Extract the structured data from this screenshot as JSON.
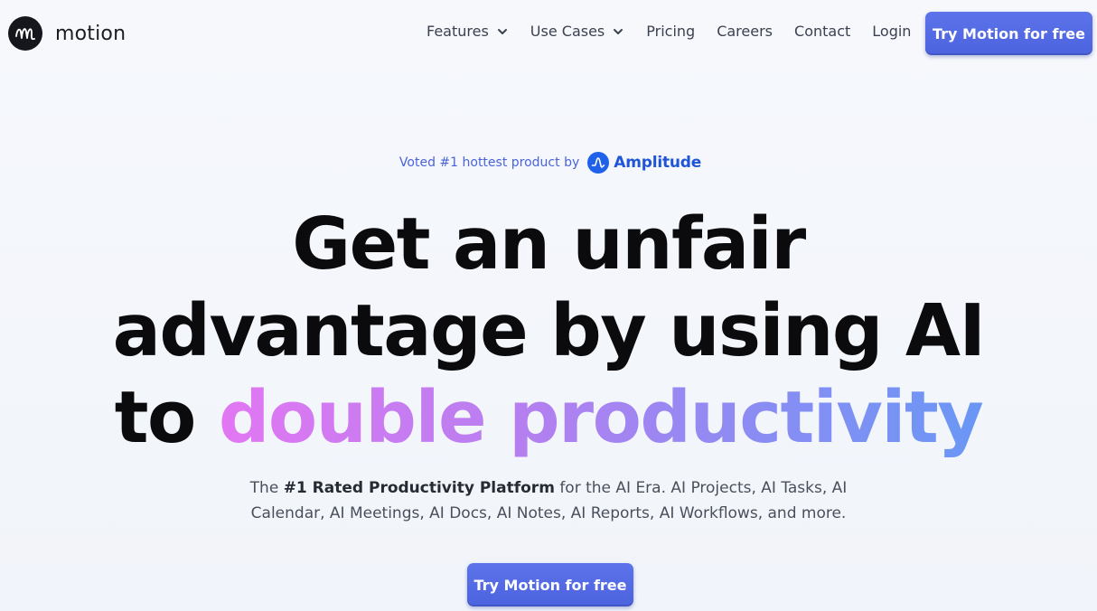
{
  "header": {
    "logo_text": "motion",
    "logo_icon": "motion-logo-icon",
    "nav": [
      {
        "label": "Features",
        "has_dropdown": true
      },
      {
        "label": "Use Cases",
        "has_dropdown": true
      },
      {
        "label": "Pricing",
        "has_dropdown": false
      },
      {
        "label": "Careers",
        "has_dropdown": false
      },
      {
        "label": "Contact",
        "has_dropdown": false
      },
      {
        "label": "Login",
        "has_dropdown": false
      }
    ],
    "cta_label": "Try Motion for free"
  },
  "hero": {
    "badge_text": "Voted #1 hottest product by",
    "badge_brand": "Amplitude",
    "badge_icon": "amplitude-logo-icon",
    "headline_line1": "Get an unfair",
    "headline_line2": "advantage by using AI",
    "headline_line3_prefix": "to",
    "headline_line3_highlight": "double productivity",
    "subtext_prefix": "The",
    "subtext_bold": "#1 Rated Productivity Platform",
    "subtext_rest": "for the AI Era. AI Projects, AI Tasks, AI",
    "subtext_line2": "Calendar, AI Meetings, AI Docs, AI Notes, AI Reports, AI Workflows, and more.",
    "cta_label": "Try Motion for free"
  },
  "colors": {
    "accent": "#5068e2",
    "headline_gradient_start": "#e277f2",
    "headline_gradient_end": "#6a97f5",
    "amplitude_blue": "#1f61e8"
  }
}
